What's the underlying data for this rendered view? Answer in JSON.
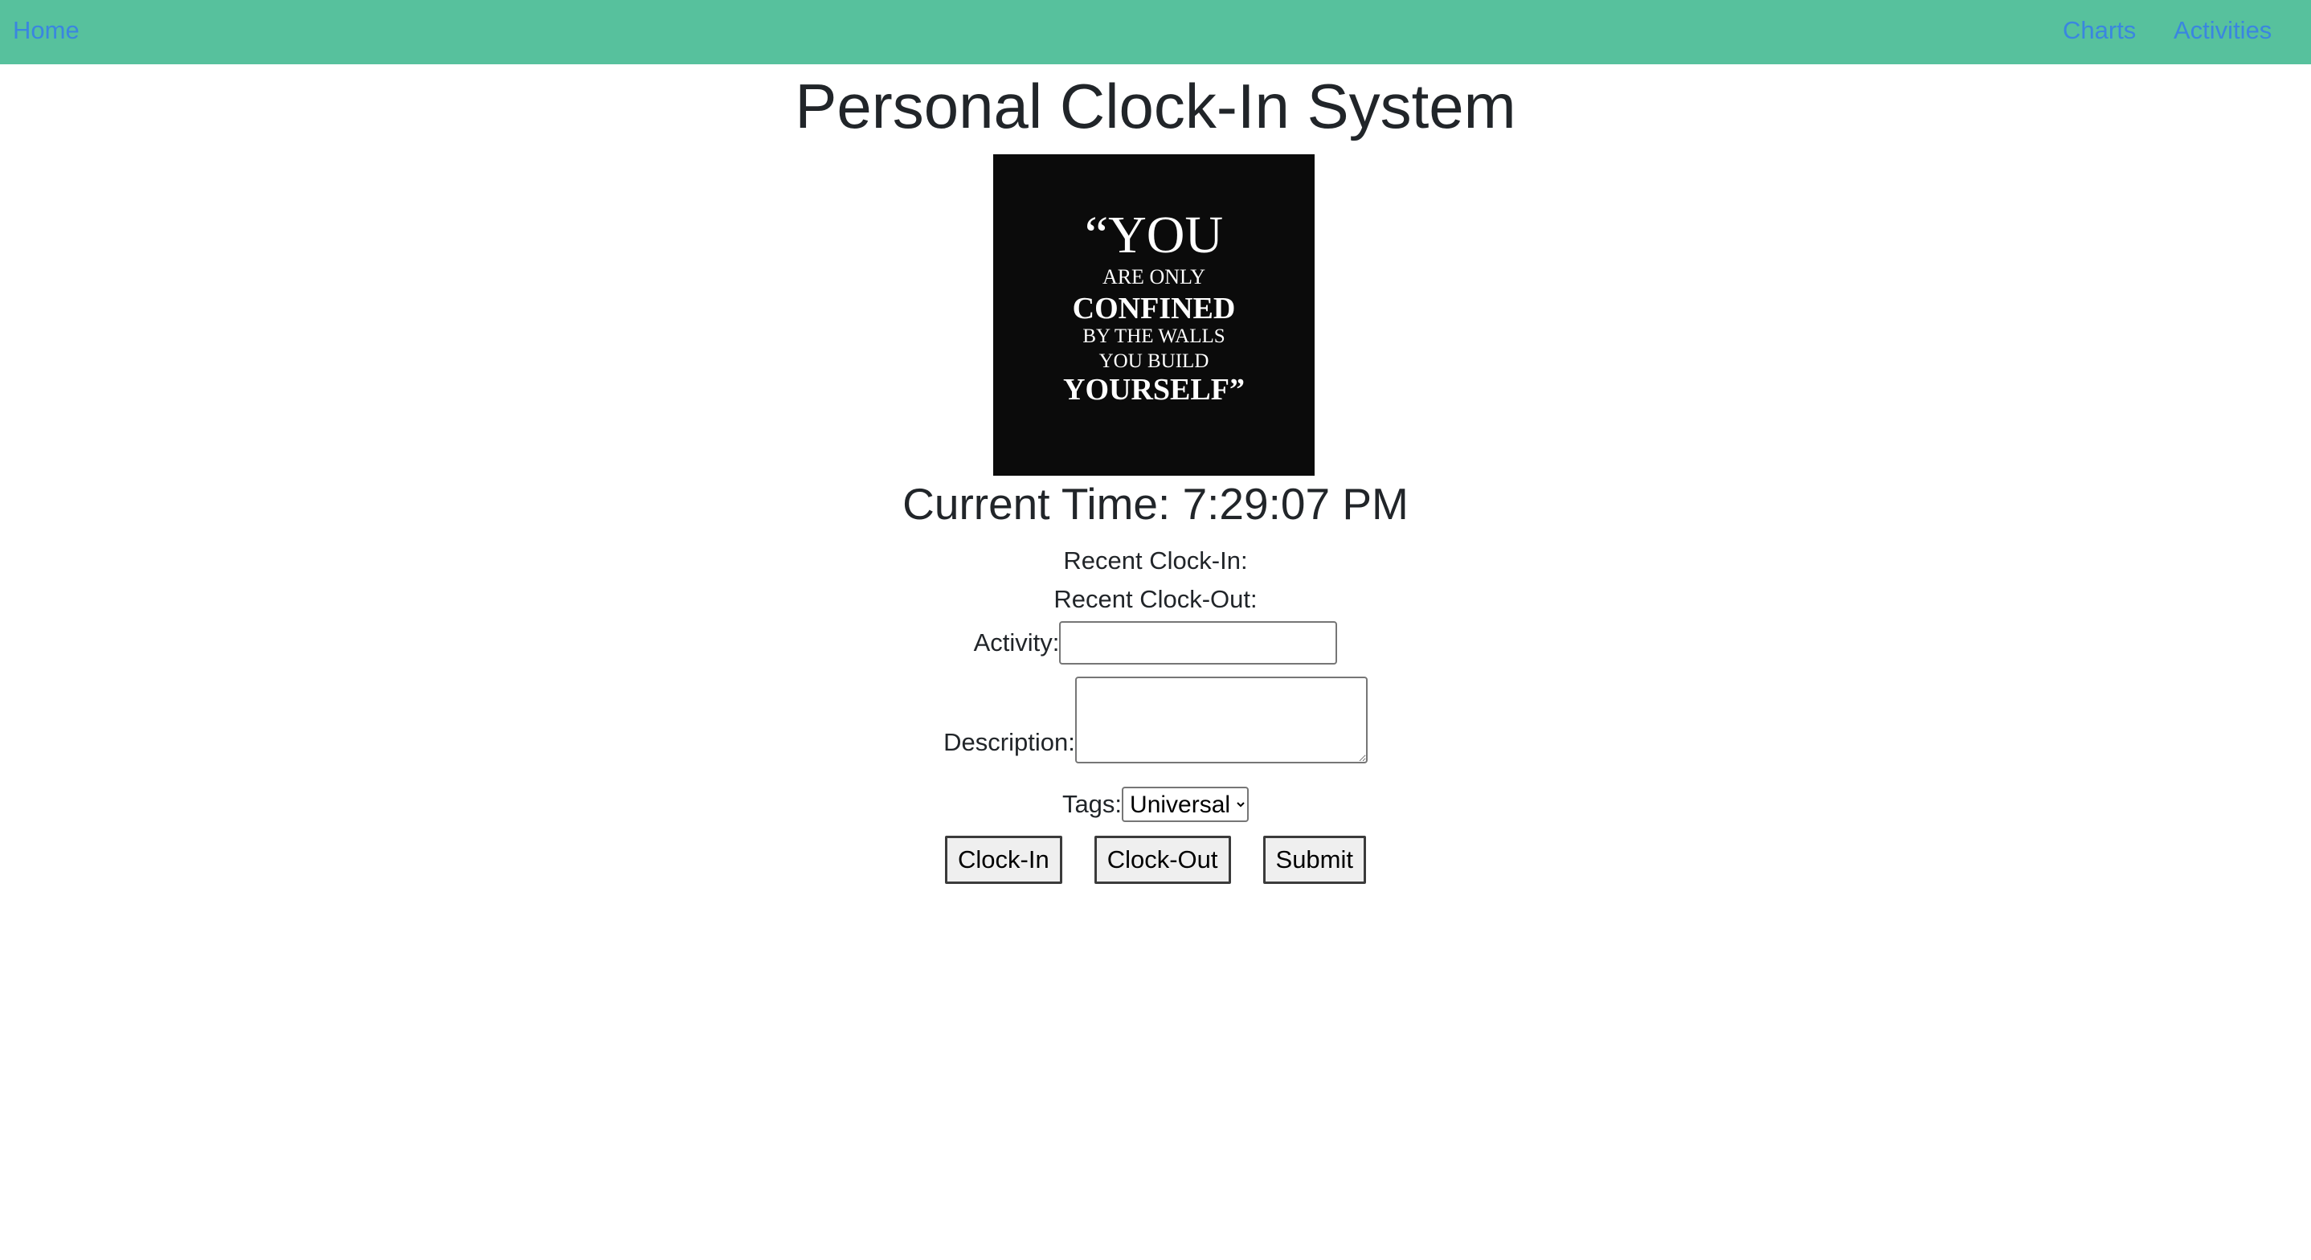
{
  "navbar": {
    "home_label": "Home",
    "charts_label": "Charts",
    "activities_label": "Activities",
    "background_color": "#57c19d",
    "link_color": "#3a86e0"
  },
  "main": {
    "title": "Personal Clock-In System",
    "quote_image": {
      "lines": [
        "“YOU",
        "ARE ONLY",
        "CONFINED",
        "BY THE WALLS",
        "YOU BUILD",
        "YOURSELF”"
      ]
    },
    "current_time": "Current Time: 7:29:07 PM",
    "recent_clock_in": "Recent Clock-In:",
    "recent_clock_out": "Recent Clock-Out:"
  },
  "form": {
    "activity_label": "Activity:",
    "activity_value": "",
    "description_label": "Description:",
    "description_value": "",
    "tags_label": "Tags:",
    "tags_selected": "Universal",
    "clock_in_label": "Clock-In",
    "clock_out_label": "Clock-Out",
    "submit_label": "Submit"
  }
}
